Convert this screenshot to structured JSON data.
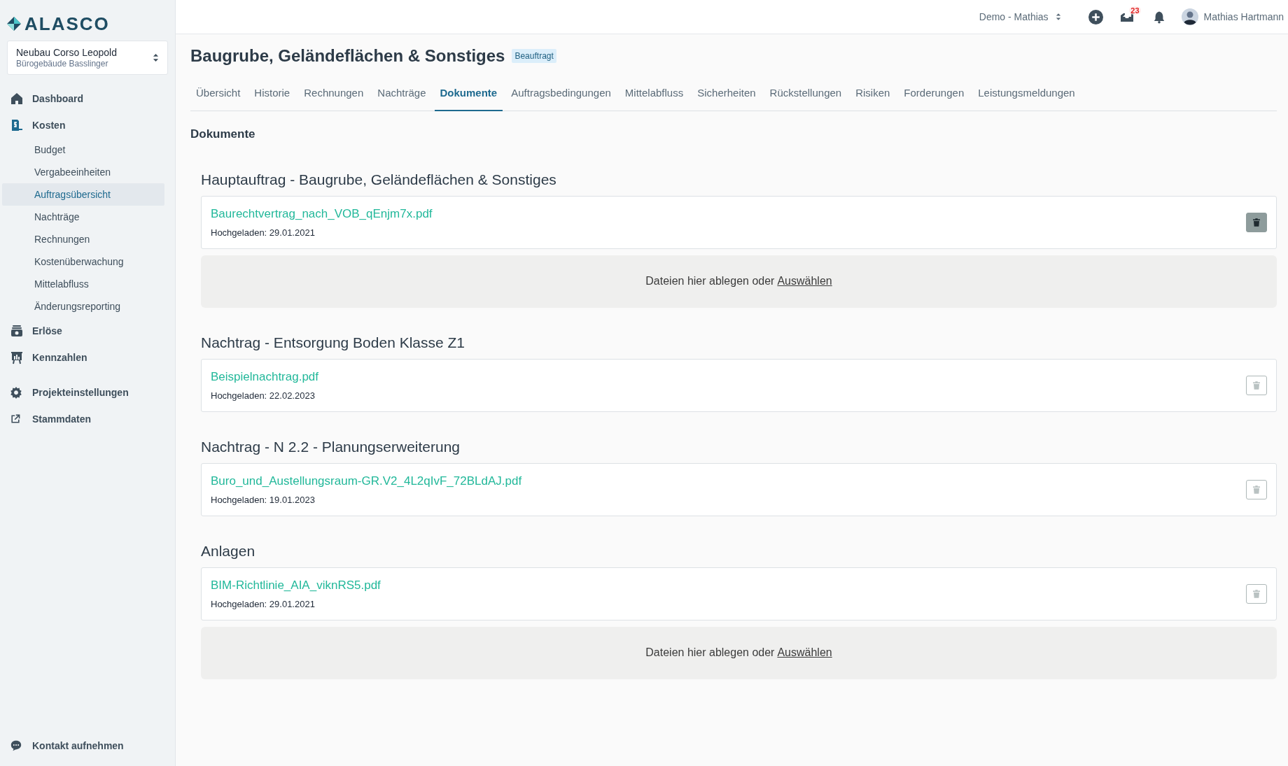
{
  "sidebar": {
    "logo": "ALASCO",
    "project": {
      "name": "Neubau Corso Leopold",
      "subtitle": "Bürogebäude Basslinger"
    },
    "items": [
      {
        "label": "Dashboard",
        "selected": false
      },
      {
        "label": "Kosten",
        "selected": false,
        "children": [
          {
            "label": "Budget",
            "selected": false
          },
          {
            "label": "Vergabeeinheiten",
            "selected": false
          },
          {
            "label": "Auftragsübersicht",
            "selected": true
          },
          {
            "label": "Nachträge",
            "selected": false
          },
          {
            "label": "Rechnungen",
            "selected": false
          },
          {
            "label": "Kostenüberwachung",
            "selected": false
          },
          {
            "label": "Mittelabfluss",
            "selected": false
          },
          {
            "label": "Änderungsreporting",
            "selected": false
          }
        ]
      },
      {
        "label": "Erlöse",
        "selected": false
      },
      {
        "label": "Kennzahlen",
        "selected": false
      },
      {
        "label": "Projekteinstellungen",
        "selected": false
      },
      {
        "label": "Stammdaten",
        "selected": false
      }
    ],
    "footer": {
      "label": "Kontakt aufnehmen"
    }
  },
  "topbar": {
    "workspace": "Demo - Mathias",
    "inbox_count": "23",
    "user": "Mathias Hartmann"
  },
  "page": {
    "title": "Baugrube, Geländeflächen & Sonstiges",
    "status": "Beauftragt",
    "tabs": [
      {
        "label": "Übersicht",
        "selected": false
      },
      {
        "label": "Historie",
        "selected": false
      },
      {
        "label": "Rechnungen",
        "selected": false
      },
      {
        "label": "Nachträge",
        "selected": false
      },
      {
        "label": "Dokumente",
        "selected": true
      },
      {
        "label": "Auftragsbedingungen",
        "selected": false
      },
      {
        "label": "Mittelabfluss",
        "selected": false
      },
      {
        "label": "Sicherheiten",
        "selected": false
      },
      {
        "label": "Rückstellungen",
        "selected": false
      },
      {
        "label": "Risiken",
        "selected": false
      },
      {
        "label": "Forderungen",
        "selected": false
      },
      {
        "label": "Leistungsmeldungen",
        "selected": false
      }
    ],
    "section_title": "Dokumente",
    "groups": [
      {
        "title": "Hauptauftrag - Baugrube, Geländeflächen & Sonstiges",
        "files": [
          {
            "name": "Baurechtvertrag_nach_VOB_qEnjm7x.pdf",
            "uploaded": "Hochgeladen: 29.01.2021",
            "hovered": true
          }
        ],
        "dropzone": {
          "text": "Dateien hier ablegen oder",
          "link": "Auswählen"
        }
      },
      {
        "title": "Nachtrag - Entsorgung Boden Klasse Z1",
        "files": [
          {
            "name": "Beispielnachtrag.pdf",
            "uploaded": "Hochgeladen: 22.02.2023",
            "hovered": false
          }
        ]
      },
      {
        "title": "Nachtrag - N 2.2 - Planungserweiterung",
        "files": [
          {
            "name": "Buro_und_Austellungsraum-GR.V2_4L2qIvF_72BLdAJ.pdf",
            "uploaded": "Hochgeladen: 19.01.2023",
            "hovered": false
          }
        ]
      },
      {
        "title": "Anlagen",
        "files": [
          {
            "name": "BIM-Richtlinie_AIA_viknRS5.pdf",
            "uploaded": "Hochgeladen: 29.01.2021",
            "hovered": false
          }
        ],
        "dropzone": {
          "text": "Dateien hier ablegen oder",
          "link": "Auswählen"
        }
      }
    ]
  }
}
